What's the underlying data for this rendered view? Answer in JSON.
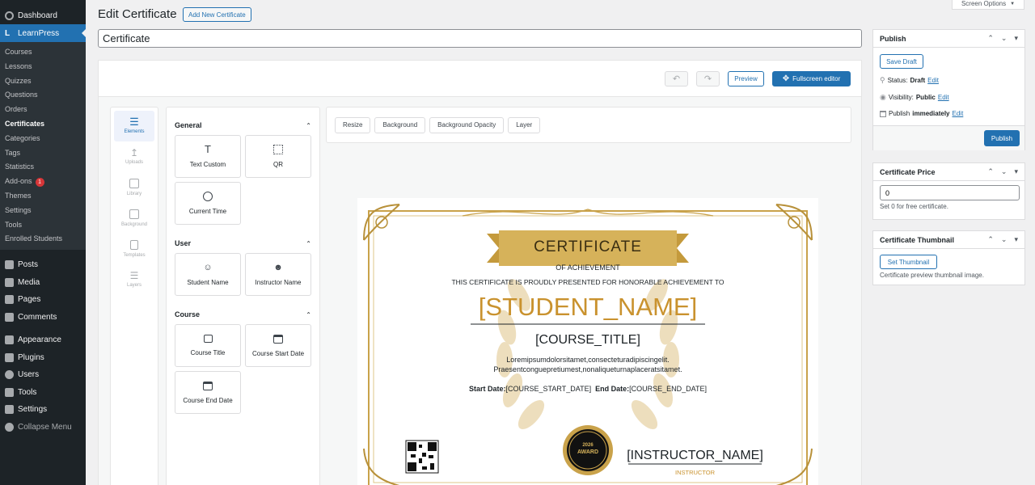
{
  "sidebar": {
    "dashboard": "Dashboard",
    "learnpress": "LearnPress",
    "sub_items": [
      "Courses",
      "Lessons",
      "Quizzes",
      "Questions",
      "Orders",
      "Certificates",
      "Categories",
      "Tags",
      "Statistics",
      "Add-ons",
      "Themes",
      "Settings",
      "Tools",
      "Enrolled Students"
    ],
    "addons_badge": "1",
    "main_items": [
      "Posts",
      "Media",
      "Pages",
      "Comments",
      "Appearance",
      "Plugins",
      "Users",
      "Tools",
      "Settings",
      "Collapse Menu"
    ]
  },
  "header": {
    "title": "Edit Certificate",
    "add_new": "Add New Certificate",
    "screen_options": "Screen Options"
  },
  "title_input": {
    "value": "Certificate"
  },
  "editor": {
    "preview": "Preview",
    "fullscreen": "Fullscreen editor",
    "tools": [
      "Elements",
      "Uploads",
      "Library",
      "Background",
      "Templates",
      "Layers"
    ],
    "sections": {
      "general": "General",
      "user": "User",
      "course": "Course"
    },
    "tiles": {
      "text_custom": "Text Custom",
      "qr": "QR",
      "current_time": "Current Time",
      "student_name": "Student Name",
      "instructor_name": "Instructor Name",
      "course_title": "Course Title",
      "course_start_date": "Course Start Date",
      "course_end_date": "Course End Date"
    },
    "canvas_toolbar": [
      "Resize",
      "Background",
      "Background Opacity",
      "Layer"
    ]
  },
  "certificate": {
    "heading": "CERTIFICATE",
    "of_achievement": "OF ACHIEVEMENT",
    "presented": "THIS CERTIFICATE IS PROUDLY PRESENTED FOR HONORABLE ACHIEVEMENT TO",
    "student": "[STUDENT_NAME]",
    "course": "[COURSE_TITLE]",
    "lorem1": "Loremipsumdolorsitamet,consecteturadipiscingelit.",
    "lorem2": "Praesentconguepretiumest,nonaliqueturnaplaceratsitamet.",
    "start_label": "Start Date:",
    "start_value": "[COURSE_START_DATE]",
    "end_label": "End Date:",
    "end_value": "[COURSE_END_DATE]",
    "award_year": "2026",
    "award_text": "AWARD",
    "instructor": "[INSTRUCTOR_NAME]",
    "instructor_label": "INSTRUCTOR"
  },
  "publish": {
    "title": "Publish",
    "save_draft": "Save Draft",
    "status_label": "Status:",
    "status_value": "Draft",
    "visibility_label": "Visibility:",
    "visibility_value": "Public",
    "publish_label": "Publish",
    "publish_value": "immediately",
    "edit": "Edit",
    "publish_btn": "Publish"
  },
  "price": {
    "title": "Certificate Price",
    "value": "0",
    "help": "Set 0 for free certificate."
  },
  "thumbnail": {
    "title": "Certificate Thumbnail",
    "set": "Set Thumbnail",
    "help": "Certificate preview thumbnail image."
  },
  "colors": {
    "admin_bg": "#1d2327",
    "accent": "#2271b1",
    "gold": "#c9a24a"
  }
}
